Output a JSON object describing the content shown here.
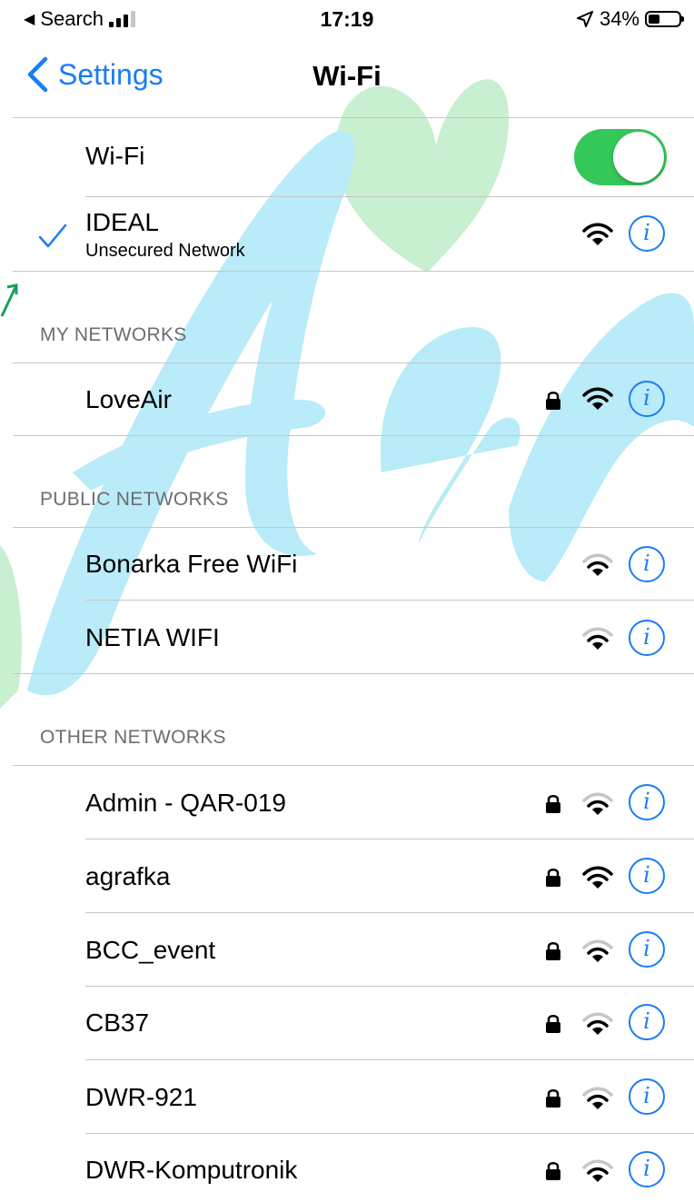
{
  "status_bar": {
    "back_label": "Search",
    "time": "17:19",
    "battery": "34%"
  },
  "nav": {
    "back_label": "Settings",
    "title": "Wi-Fi"
  },
  "wifi_toggle": {
    "label": "Wi-Fi",
    "on": true
  },
  "connected": {
    "name": "IDEAL",
    "subtitle": "Unsecured Network",
    "signal": "full"
  },
  "sections": {
    "my_networks": "MY NETWORKS",
    "public_networks": "PUBLIC NETWORKS",
    "other_networks": "OTHER NETWORKS"
  },
  "my_networks": [
    {
      "name": "LoveAir",
      "locked": true,
      "signal": "full"
    }
  ],
  "public_networks": [
    {
      "name": "Bonarka Free WiFi",
      "locked": false,
      "signal": "medium"
    },
    {
      "name": "NETIA WIFI",
      "locked": false,
      "signal": "medium"
    }
  ],
  "other_networks": [
    {
      "name": "Admin - QAR-019",
      "locked": true,
      "signal": "medium"
    },
    {
      "name": "agrafka",
      "locked": true,
      "signal": "full"
    },
    {
      "name": "BCC_event",
      "locked": true,
      "signal": "medium"
    },
    {
      "name": "CB37",
      "locked": true,
      "signal": "medium"
    },
    {
      "name": "DWR-921",
      "locked": true,
      "signal": "medium"
    },
    {
      "name": "DWR-Komputronik",
      "locked": true,
      "signal": "medium"
    }
  ],
  "colors": {
    "accent": "#1a7cf5",
    "toggle_on": "#34c759",
    "watermark_blue": "#aee6f7",
    "watermark_green": "#c8efcf"
  },
  "icons": {
    "info": "i",
    "back": "chevron-left-icon",
    "lock": "lock-icon",
    "wifi": "wifi-icon"
  }
}
